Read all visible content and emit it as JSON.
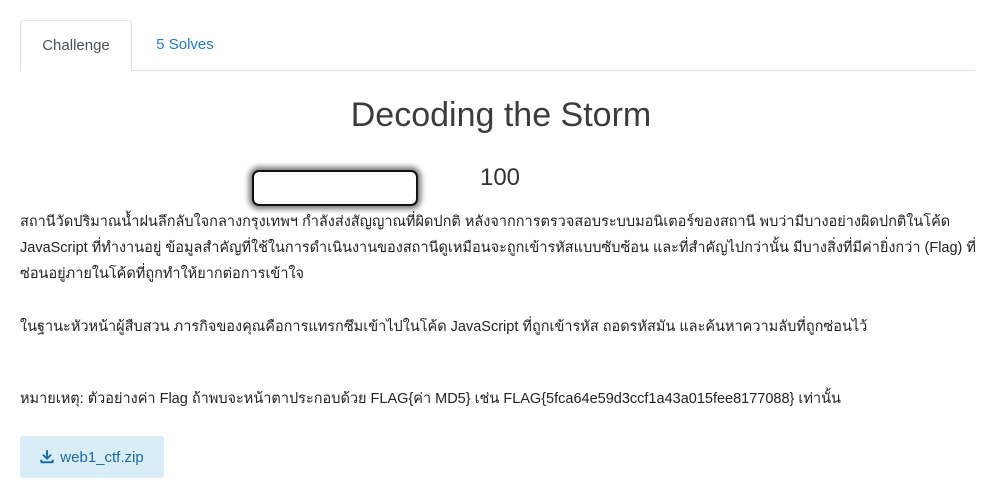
{
  "tabs": {
    "challenge": "Challenge",
    "solves": "5 Solves"
  },
  "challenge": {
    "title": "Decoding the Storm",
    "points": "100",
    "paragraph1": "สถานีวัดปริมาณน้ำฝนลึกลับใจกลางกรุงเทพฯ กำลังส่งสัญญาณที่ผิดปกติ หลังจากการตรวจสอบระบบมอนิเตอร์ของสถานี พบว่ามีบางอย่างผิดปกติในโค้ด JavaScript ที่ทำงานอยู่ ข้อมูลสำคัญที่ใช้ในการดำเนินงานของสถานีดูเหมือนจะถูกเข้ารหัสแบบซับซ้อน และที่สำคัญไปกว่านั้น มีบางสิ่งที่มีค่ายิ่งกว่า (Flag) ที่ซ่อนอยู่ภายในโค้ดที่ถูกทำให้ยากต่อการเข้าใจ",
    "paragraph2": "ในฐานะหัวหน้าผู้สืบสวน ภารกิจของคุณคือการแทรกซึมเข้าไปในโค้ด JavaScript ที่ถูกเข้ารหัส ถอดรหัสมัน และค้นหาความลับที่ถูกซ่อนไว้",
    "note": "หมายเหตุ: ตัวอย่างค่า Flag ถ้าพบจะหน้าตาประกอบด้วย FLAG{ค่า MD5} เช่น FLAG{5fca64e59d3ccf1a43a015fee8177088} เท่านั้น"
  },
  "attachment": {
    "filename": "web1_ctf.zip",
    "icon": "download-icon"
  },
  "colors": {
    "link": "#1e7bd3",
    "button_bg": "#d9edf7",
    "button_text": "#1a6aa8"
  }
}
